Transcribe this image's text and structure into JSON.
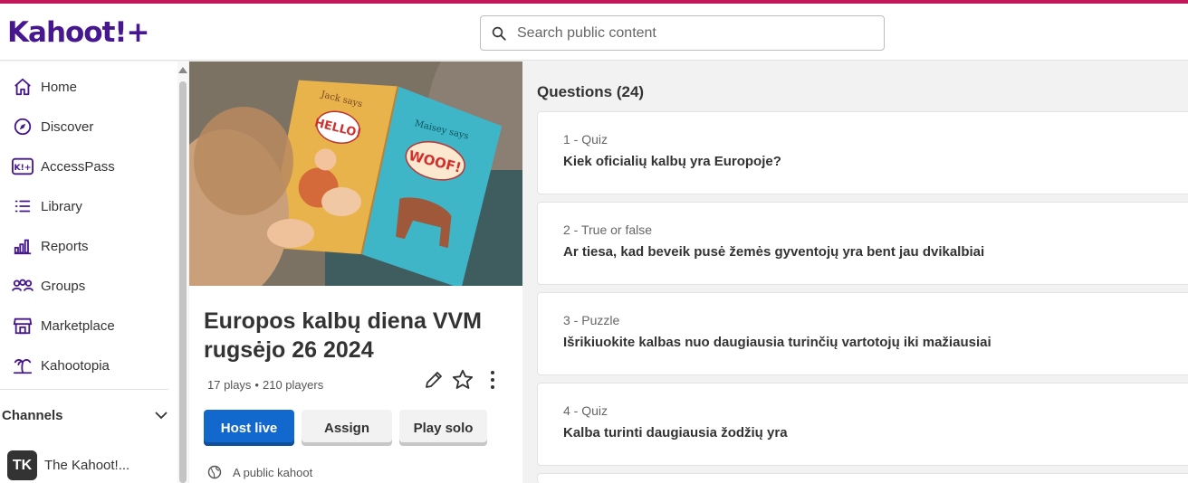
{
  "header": {
    "logo": "Kahoot!+",
    "search_placeholder": "Search public content"
  },
  "sidebar": {
    "items": [
      {
        "label": "Home",
        "icon": "home-icon"
      },
      {
        "label": "Discover",
        "icon": "compass-icon"
      },
      {
        "label": "AccessPass",
        "icon": "accesspass-icon"
      },
      {
        "label": "Library",
        "icon": "list-icon"
      },
      {
        "label": "Reports",
        "icon": "reports-icon"
      },
      {
        "label": "Groups",
        "icon": "groups-icon"
      },
      {
        "label": "Marketplace",
        "icon": "store-icon"
      },
      {
        "label": "Kahootopia",
        "icon": "island-icon"
      }
    ],
    "channels_label": "Channels",
    "channel": {
      "initials": "TK",
      "name": "The Kahoot!..."
    }
  },
  "kahoot": {
    "title": "Europos kalbų diena VVM rugsėjo 26 2024",
    "plays": "17 plays",
    "separator": "•",
    "players": "210 players",
    "host_label": "Host live",
    "assign_label": "Assign",
    "solo_label": "Play solo",
    "visibility": "A public kahoot",
    "cover_text": {
      "left_caption": "Jack says",
      "left_word": "HELLO!",
      "right_caption": "Maisey says",
      "right_word": "WOOF!"
    }
  },
  "questions": {
    "header": "Questions (24)",
    "items": [
      {
        "meta": "1 - Quiz",
        "text": "Kiek oficialių kalbų yra Europoje?"
      },
      {
        "meta": "2 - True or false",
        "text": "Ar tiesa, kad beveik pusė žemės gyventojų yra bent jau dvikalbiai"
      },
      {
        "meta": "3 - Puzzle",
        "text": "Išrikiuokite kalbas nuo daugiausia turinčių vartotojų iki mažiausiai"
      },
      {
        "meta": "4 - Quiz",
        "text": "Kalba turinti daugiausia žodžių yra"
      }
    ]
  },
  "colors": {
    "brand": "#46178f",
    "accent": "#c2185b",
    "primary_button": "#1368ce"
  }
}
